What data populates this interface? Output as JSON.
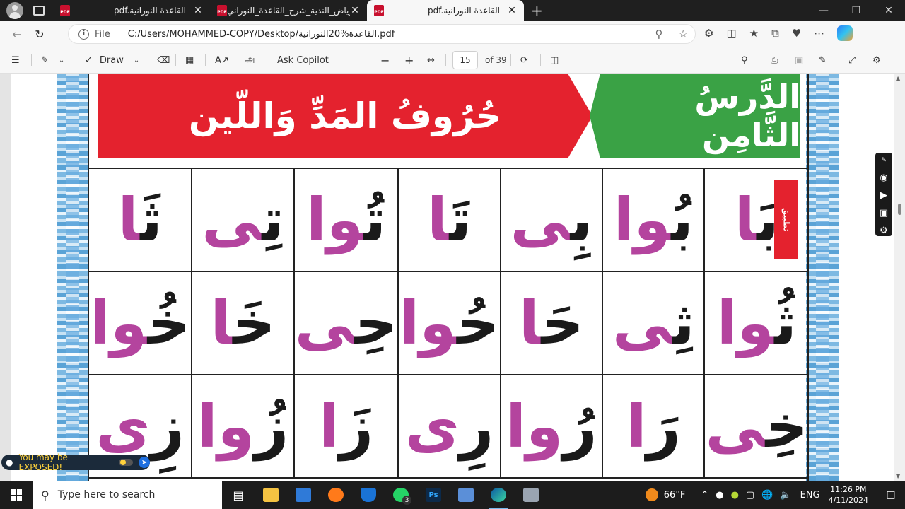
{
  "tabs": [
    {
      "title": "pdf.القاعدة النورانية",
      "close": "✕"
    },
    {
      "title": "الرياض_الندية_شرح_القاعدة_النوراني",
      "close": "✕"
    },
    {
      "title": "pdf.القاعدة النورانية",
      "close": "✕",
      "active": true
    }
  ],
  "tab_favicon_text": "PDF",
  "new_tab": "+",
  "window_controls": {
    "minimize": "—",
    "maximize": "❐",
    "close": "✕"
  },
  "address": {
    "scheme_label": "File",
    "url": "C:/Users/MOHAMMED-COPY/Desktop/القاعدة%20النورانية.pdf"
  },
  "pdf_toolbar": {
    "draw_label": "Draw",
    "ask_copilot_label": "Ask Copilot",
    "zoom_out": "−",
    "zoom_in": "+",
    "current_page": "15",
    "total_pages": "of 39"
  },
  "document": {
    "lesson_title": "الدَّرسُ الثَّامِن",
    "topic_title": "حُرُوفُ المَدِّ وَاللّين",
    "apply_tag": "تطبيق",
    "rows": [
      [
        {
          "b": "بَ",
          "m": "ا"
        },
        {
          "b": "بُ",
          "m": "وا"
        },
        {
          "b": "بِ",
          "m": "ى"
        },
        {
          "b": "تَ",
          "m": "ا"
        },
        {
          "b": "تُ",
          "m": "وا"
        },
        {
          "b": "تِ",
          "m": "ى"
        },
        {
          "b": "ثَ",
          "m": "ا"
        }
      ],
      [
        {
          "b": "ثُ",
          "m": "وا"
        },
        {
          "b": "ثِ",
          "m": "ى"
        },
        {
          "b": "حَ",
          "m": "ا"
        },
        {
          "b": "حُ",
          "m": "وا"
        },
        {
          "b": "حِ",
          "m": "ى"
        },
        {
          "b": "خَ",
          "m": "ا"
        },
        {
          "b": "خُ",
          "m": "وا"
        }
      ],
      [
        {
          "b": "خِ",
          "m": "ى"
        },
        {
          "b": "رَ",
          "m": "ا"
        },
        {
          "b": "رُ",
          "m": "وا"
        },
        {
          "b": "رِ",
          "m": "ى"
        },
        {
          "b": "زَ",
          "m": "ا"
        },
        {
          "b": "زُ",
          "m": "وا"
        },
        {
          "b": "زِ",
          "m": "ى"
        }
      ]
    ],
    "colors": {
      "red_banner": "#e4222e",
      "green_banner": "#3aa245",
      "magenta": "#b4449e"
    }
  },
  "warning": {
    "text": "You may be EXPOSED!"
  },
  "taskbar": {
    "search_placeholder": "Type here to search",
    "whatsapp_badge": "3",
    "ps_label": "Ps",
    "weather": "66°F",
    "language": "ENG",
    "time": "11:26 PM",
    "date": "4/11/2024"
  }
}
